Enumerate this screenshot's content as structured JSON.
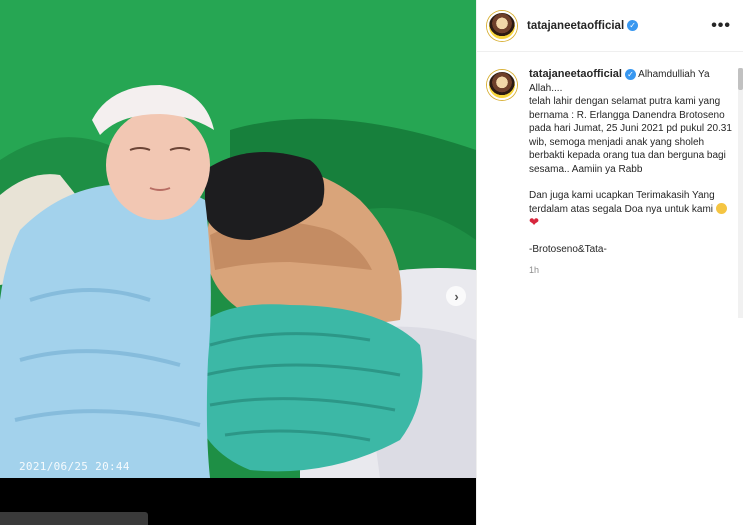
{
  "post": {
    "username": "tatajaneetaofficial",
    "verified_icon": "verified-badge-icon",
    "more_icon": "more-options-icon",
    "more_label": "•••",
    "photo_timestamp": "2021/06/25 20:44",
    "next_icon": "chevron-right-icon",
    "next_label": "›"
  },
  "caption": {
    "username": "tatajaneetaofficial",
    "first_line": "Alhamdulliah Ya Allah....",
    "paragraph1": "telah lahir dengan selamat putra kami yang bernama : R. Erlangga Danendra Brotoseno pada hari Jumat, 25 Juni 2021 pd pukul 20.31 wib, semoga menjadi anak yang sholeh berbakti kepada orang tua dan berguna bagi sesama.. Aamiin ya Rabb",
    "paragraph2": "Dan juga kami ucapkan Terimakasih Yang terdalam atas segala Doa nya untuk kami",
    "emoji1": "smiling-face-icon",
    "emoji2": "heart-icon",
    "heart_glyph": "❤",
    "signature": "-Brotoseno&Tata-",
    "time_ago": "1h"
  },
  "colors": {
    "accent_blue": "#3897f0",
    "drape_green": "#1f9a4a",
    "cap_teal": "#3bb7a7",
    "blanket_blue": "#9fd0ec"
  }
}
